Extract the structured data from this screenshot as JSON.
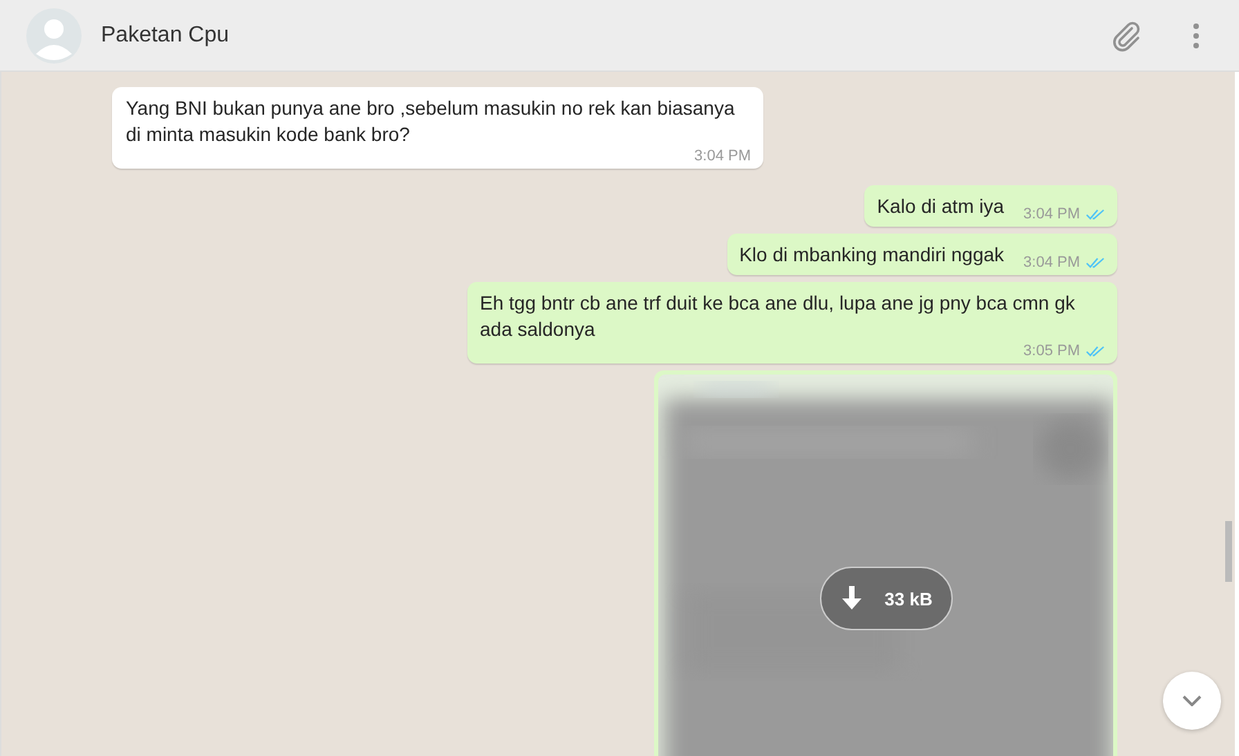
{
  "header": {
    "title": "Paketan Cpu"
  },
  "messages": [
    {
      "kind": "text",
      "outgoing": false,
      "text": "Yang BNI bukan punya ane bro ,sebelum masukin no rek kan biasanya di minta masukin kode bank bro?",
      "time": "3:04 PM"
    },
    {
      "kind": "text",
      "outgoing": true,
      "text": "Kalo di atm iya",
      "time": "3:04 PM",
      "read": true
    },
    {
      "kind": "text",
      "outgoing": true,
      "text": "Klo di mbanking mandiri nggak",
      "time": "3:04 PM",
      "read": true
    },
    {
      "kind": "text",
      "outgoing": true,
      "text": "Eh tgg bntr cb ane trf duit ke bca ane dlu, lupa ane jg pny bca cmn gk ada saldonya",
      "time": "3:05 PM",
      "read": true
    },
    {
      "outgoing": true,
      "size": "33 kB"
    }
  ]
}
